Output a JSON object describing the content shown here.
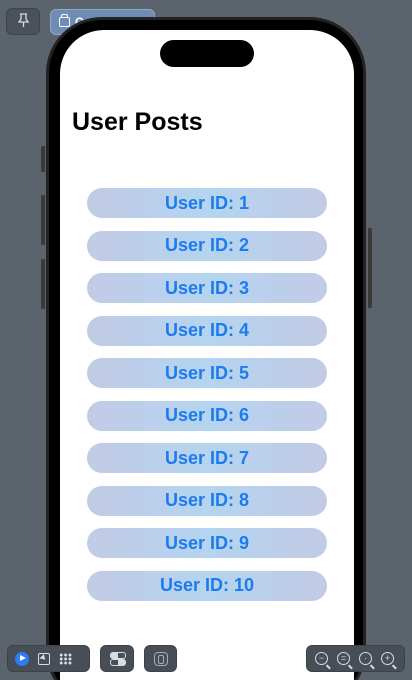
{
  "toolbar": {
    "pin_icon": "pin-icon",
    "tab_label": "Content View",
    "tab_icon": "window-icon"
  },
  "screen": {
    "title": "User Posts",
    "posts": [
      {
        "label": "User ID: 1"
      },
      {
        "label": "User ID: 2"
      },
      {
        "label": "User ID: 3"
      },
      {
        "label": "User ID: 4"
      },
      {
        "label": "User ID: 5"
      },
      {
        "label": "User ID: 6"
      },
      {
        "label": "User ID: 7"
      },
      {
        "label": "User ID: 8"
      },
      {
        "label": "User ID: 9"
      },
      {
        "label": "User ID: 10"
      }
    ]
  },
  "bottom_bar": {
    "icons": [
      "live-preview-icon",
      "selectable-icon",
      "variants-icon",
      "device-settings-icon",
      "canvas-settings-icon",
      "zoom-out-icon",
      "zoom-fit-icon",
      "zoom-100-icon",
      "zoom-in-icon"
    ]
  },
  "colors": {
    "background": "#5b636c",
    "accent": "#1d7bf0",
    "tab_active": "#6f8db3",
    "pill_gradient": [
      "#c2cbe6",
      "#b4d4ef"
    ]
  }
}
